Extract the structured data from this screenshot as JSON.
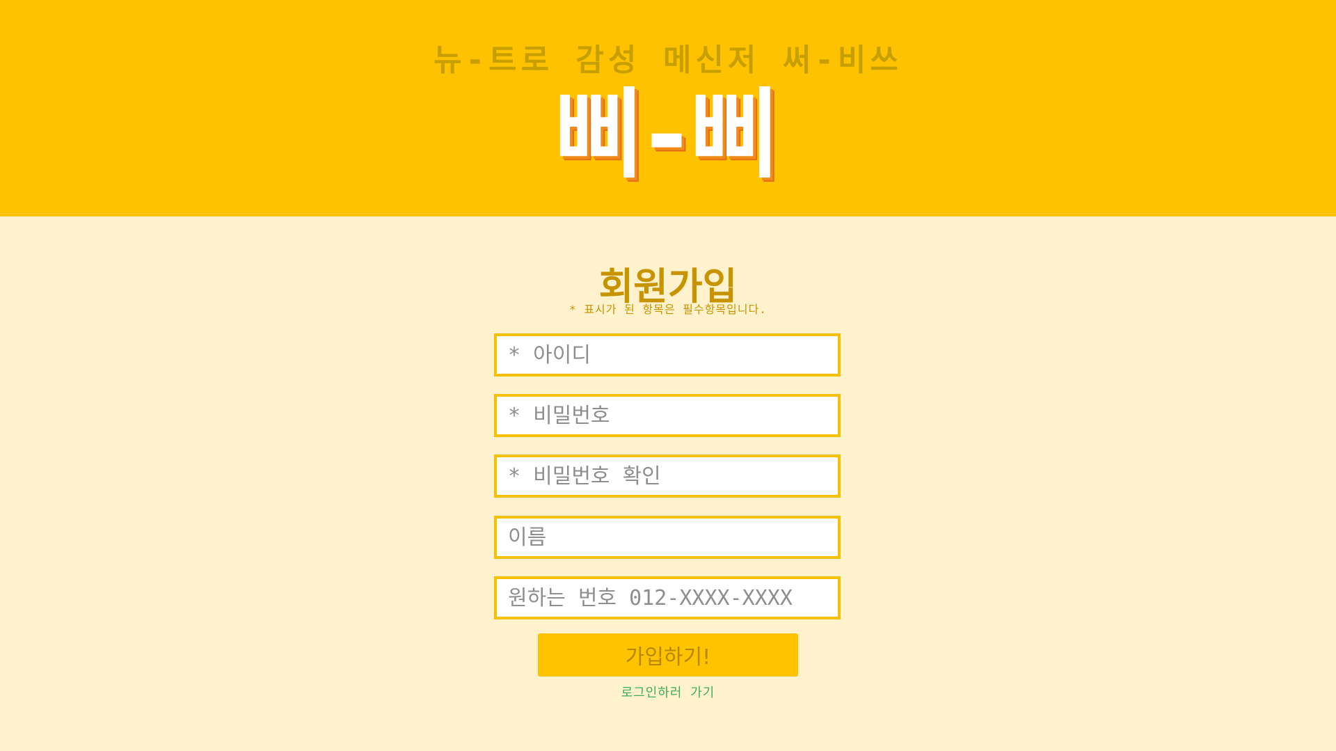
{
  "header": {
    "tagline": "뉴-트로 감성 메신저 써-비쓰",
    "logo": "삐-삐"
  },
  "signup": {
    "title": "회원가입",
    "note": "* 표시가 된 항목은 필수항목입니다.",
    "fields": [
      {
        "placeholder": "* 아이디"
      },
      {
        "placeholder": "* 비밀번호"
      },
      {
        "placeholder": "* 비밀번호 확인"
      },
      {
        "placeholder": "이름"
      },
      {
        "placeholder": "원하는 번호 012-XXXX-XXXX"
      }
    ],
    "submit_label": "가입하기!",
    "login_link": "로그인하러 가기"
  },
  "colors": {
    "header_bg": "#ffc200",
    "page_bg": "#fff2cc",
    "accent": "#c79400",
    "field_border": "#f7c000",
    "link": "#3fae5a"
  }
}
